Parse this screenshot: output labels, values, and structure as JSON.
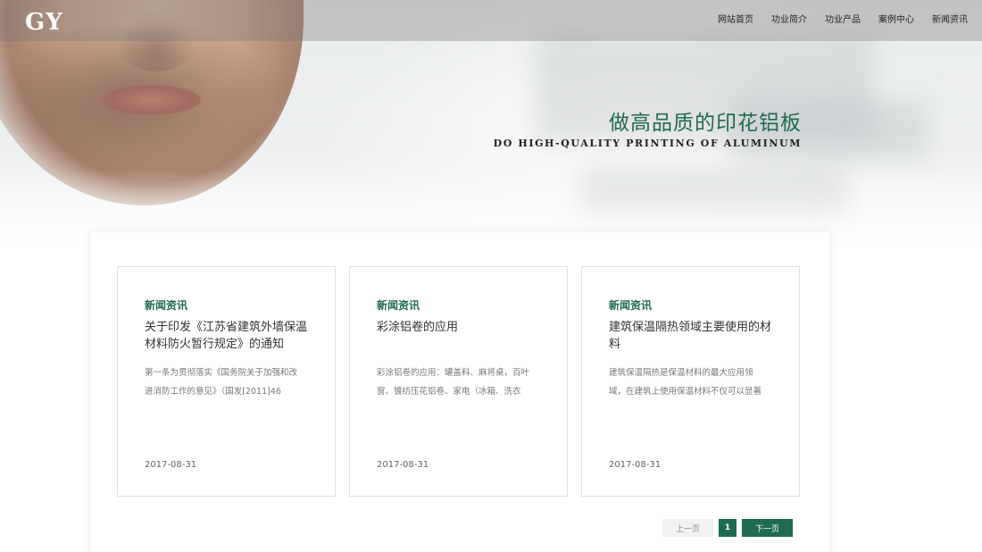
{
  "header": {
    "logo": "GY",
    "nav": [
      "网站首页",
      "功业简介",
      "功业产品",
      "案例中心",
      "新闻资讯"
    ]
  },
  "hero": {
    "slogan_cn": "做高品质的印花铝板",
    "slogan_en": "DO HIGH-QUALITY PRINTING OF ALUMINUM"
  },
  "news": [
    {
      "category": "新闻资讯",
      "title": "关于印发《江苏省建筑外墙保温材料防火暂行规定》的通知",
      "summary": "第一条为贯彻落实《国务院关于加强和改进消防工作的意见》（国发[2011]46",
      "date": "2017-08-31"
    },
    {
      "category": "新闻资讯",
      "title": "彩涂铝卷的应用",
      "summary": "彩涂铝卷的应用：罐盖料、麻将桌，百叶窗、镀纺压花铝卷、家电（冰箱、洗衣",
      "date": "2017-08-31"
    },
    {
      "category": "新闻资讯",
      "title": "建筑保温隔热领域主要使用的材料",
      "summary": "建筑保温隔热是保温材料的最大应用领域，在建筑上使用保温材料不仅可以显著",
      "date": "2017-08-31"
    }
  ],
  "pagination": {
    "prev": "上一页",
    "current": "1",
    "next": "下一页"
  },
  "colors": {
    "accent": "#1f6a52"
  }
}
